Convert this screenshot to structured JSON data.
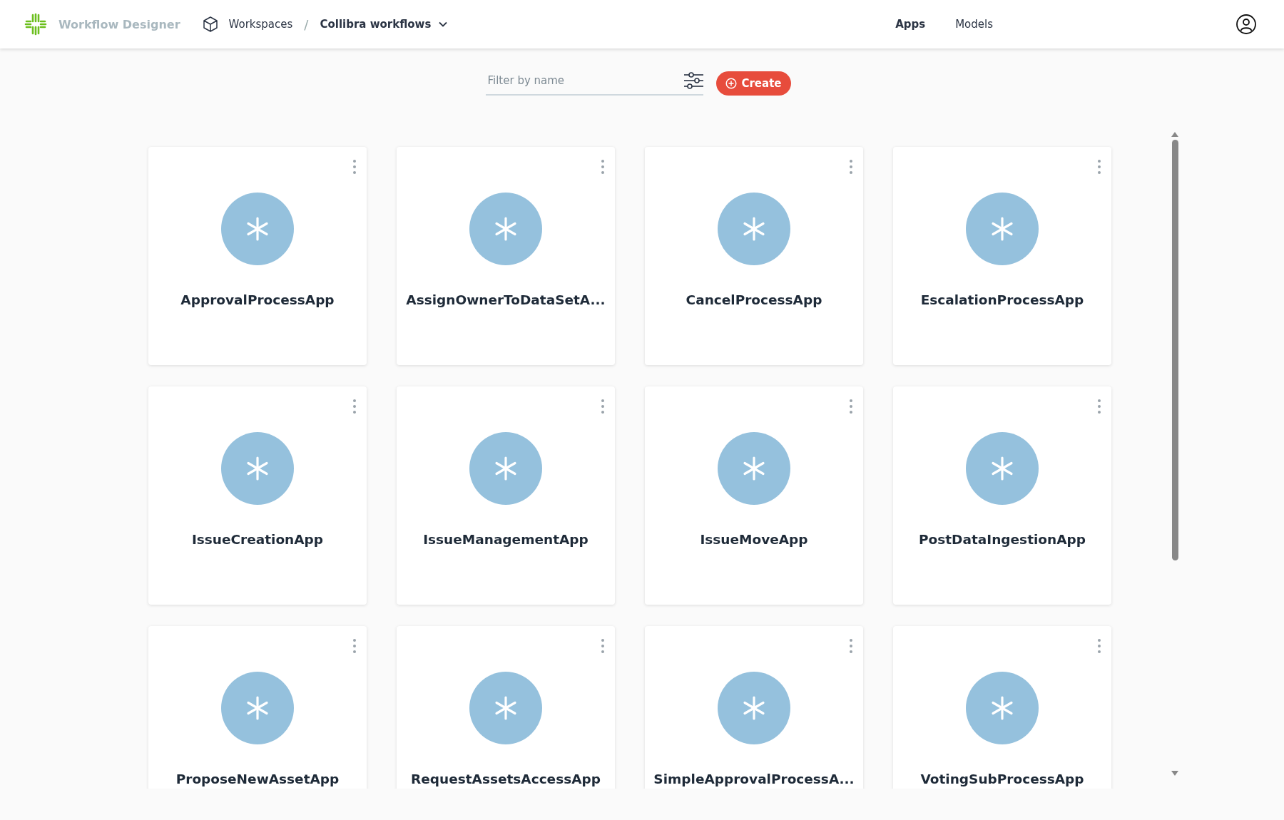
{
  "app": {
    "title": "Workflow Designer"
  },
  "breadcrumb": [
    {
      "label": "Workspaces",
      "kind": "link"
    },
    {
      "label": "Collibra workflows",
      "kind": "current"
    }
  ],
  "breadcrumb_separator": "/",
  "nav": [
    {
      "label": "Apps",
      "selected": true
    },
    {
      "label": "Models",
      "selected": false
    }
  ],
  "filter": {
    "placeholder": "Filter by name"
  },
  "create_button": "Create",
  "apps": [
    {
      "name": "ApprovalProcessApp"
    },
    {
      "name": "AssignOwnerToDataSetA..."
    },
    {
      "name": "CancelProcessApp"
    },
    {
      "name": "EscalationProcessApp"
    },
    {
      "name": "IssueCreationApp"
    },
    {
      "name": "IssueManagementApp"
    },
    {
      "name": "IssueMoveApp"
    },
    {
      "name": "PostDataIngestionApp"
    },
    {
      "name": "ProposeNewAssetApp"
    },
    {
      "name": "RequestAssetsAccessApp"
    },
    {
      "name": "SimpleApprovalProcessA..."
    },
    {
      "name": "VotingSubProcessApp"
    }
  ]
}
